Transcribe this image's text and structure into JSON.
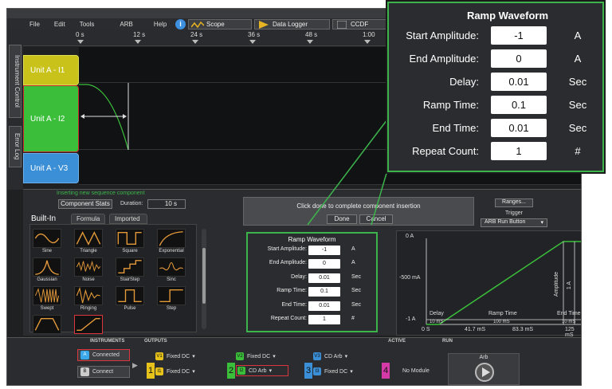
{
  "menu": [
    "File",
    "Edit",
    "Tools",
    "ARB",
    "Help"
  ],
  "toolbar": {
    "scope": "Scope",
    "datalogger": "Data Logger",
    "ccdf": "CCDF",
    "info": "i"
  },
  "side_tabs": {
    "instrument_control": "Instrument Control",
    "error_log": "Error Log"
  },
  "timeline": {
    "ticks": [
      "0 s",
      "12 s",
      "24 s",
      "36 s",
      "48 s",
      "1:00"
    ]
  },
  "channels": [
    {
      "label": "Unit A - I1",
      "color": "#c8c21a"
    },
    {
      "label": "Unit A - I2",
      "color": "#3bbf3b"
    },
    {
      "label": "Unit A - V3",
      "color": "#3a8fd6"
    }
  ],
  "sequence": {
    "status": "Inserting new sequence component",
    "component_stats": "Component Stats",
    "duration_label": "Duration:",
    "duration_value": "10 s",
    "insert_msg": "Click done to complete component insertion",
    "done": "Done",
    "cancel": "Cancel",
    "ranges": "Ranges...",
    "trigger": "Trigger",
    "trigger_value": "ARB Run Button"
  },
  "library": {
    "tabs": [
      "Built-In",
      "Formula",
      "Imported"
    ],
    "items": [
      "Sine",
      "Triangle",
      "Square",
      "Exponential",
      "Gaussian",
      "Noise",
      "StairStep",
      "Sinc",
      "Swept",
      "Ringing",
      "Pulse",
      "Step"
    ]
  },
  "ramp": {
    "title": "Ramp Waveform",
    "fields": [
      {
        "label": "Start Amplitude:",
        "value": "-1",
        "unit": "A"
      },
      {
        "label": "End Amplitude:",
        "value": "0",
        "unit": "A"
      },
      {
        "label": "Delay:",
        "value": "0.01",
        "unit": "Sec"
      },
      {
        "label": "Ramp Time:",
        "value": "0.1",
        "unit": "Sec"
      },
      {
        "label": "End Time:",
        "value": "0.01",
        "unit": "Sec"
      },
      {
        "label": "Repeat Count:",
        "value": "1",
        "unit": "#"
      }
    ]
  },
  "preview": {
    "y_ticks": [
      "0 A",
      "-500 mA",
      "-1 A"
    ],
    "x_ticks": [
      "0 S",
      "41.7 mS",
      "83.3 mS",
      "125 mS"
    ],
    "annotations": {
      "delay": "Delay",
      "ramp_time": "Ramp Time",
      "end_time": "End Time",
      "amplitude": "Amplitude",
      "amp_value": "1 A",
      "dur_10": "10 mS",
      "dur_100": "100 mS",
      "dur_10b": "10 mS"
    }
  },
  "bottom": {
    "instruments": "INSTRUMENTS",
    "outputs": "OUTPUTS",
    "active": "ACTIVE",
    "run": "RUN",
    "connected": "Connected",
    "connect": "Connect",
    "unit_a": "A",
    "unit_b": "B",
    "out1_v": "Fixed DC",
    "out1_i": "Fixed DC",
    "out2_v": "Fixed DC",
    "out2_i": "CD Arb",
    "out3_v": "CD Arb",
    "out3_i": "Fixed DC",
    "out4": "No Module",
    "arb": "Arb",
    "n1": "1",
    "n2": "2",
    "n3": "3",
    "n4": "4",
    "v1": "V1",
    "i1": "I1",
    "v2": "V2",
    "i2": "I2",
    "v3": "V3",
    "i3": "I3"
  }
}
